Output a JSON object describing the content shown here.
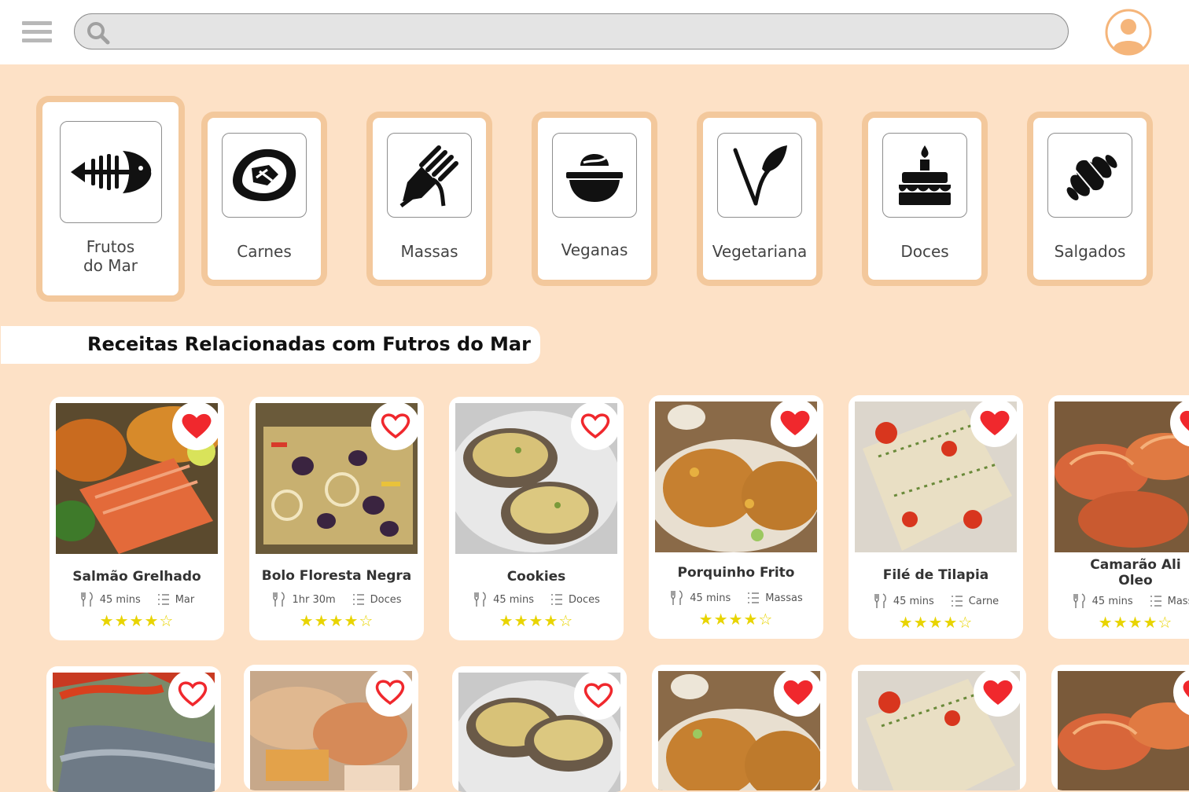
{
  "header": {
    "menu_icon": "hamburger-menu-icon",
    "search_icon": "search-icon",
    "search_value": "",
    "search_placeholder": "",
    "avatar_icon": "user-avatar-icon",
    "accent_color": "#F5B57A"
  },
  "categories": [
    {
      "label_line1": "Frutos",
      "label_line2": "do Mar",
      "icon": "fish-bone-icon",
      "selected": true
    },
    {
      "label_line1": "Carnes",
      "label_line2": "",
      "icon": "steak-icon",
      "selected": false
    },
    {
      "label_line1": "Massas",
      "label_line2": "",
      "icon": "pasta-fork-icon",
      "selected": false
    },
    {
      "label_line1": "Veganas",
      "label_line2": "",
      "icon": "bowl-icon",
      "selected": false
    },
    {
      "label_line1": "Vegetariana",
      "label_line2": "",
      "icon": "leaf-sprout-icon",
      "selected": false
    },
    {
      "label_line1": "Doces",
      "label_line2": "",
      "icon": "cake-icon",
      "selected": false
    },
    {
      "label_line1": "Salgados",
      "label_line2": "",
      "icon": "croissant-icon",
      "selected": false
    }
  ],
  "section_title": "Receitas Relacionadas com Futros do Mar",
  "recipes_row1": [
    {
      "title": "Salmão Grelhado",
      "time": "45 mins",
      "category": "Mar",
      "rating": 4,
      "max_rating": 5,
      "favorite": true
    },
    {
      "title": "Bolo Floresta Negra",
      "time": "1hr 30m",
      "category": "Doces",
      "rating": 4,
      "max_rating": 5,
      "favorite": false
    },
    {
      "title": "Cookies",
      "time": "45 mins",
      "category": "Doces",
      "rating": 4,
      "max_rating": 5,
      "favorite": false
    },
    {
      "title": "Porquinho Frito",
      "time": "45 mins",
      "category": "Massas",
      "rating": 4,
      "max_rating": 5,
      "favorite": true
    },
    {
      "title": "Filé de Tilapia",
      "time": "45 mins",
      "category": "Carne",
      "rating": 4,
      "max_rating": 5,
      "favorite": true
    },
    {
      "title": "Camarão Ali Oleo",
      "title_line1": "Camarão Ali",
      "title_line2": "Oleo",
      "time": "45 mins",
      "category": "Massa",
      "rating": 4,
      "max_rating": 5,
      "favorite": true
    }
  ],
  "recipes_row2": [
    {
      "favorite": false
    },
    {
      "favorite": false
    },
    {
      "favorite": false
    },
    {
      "favorite": true
    },
    {
      "favorite": true
    },
    {
      "favorite": true
    }
  ],
  "icons": {
    "utensils": "fork-knife-icon",
    "list": "list-icon",
    "star": "star-icon",
    "heart": "heart-icon"
  },
  "colors": {
    "background": "#FDE1C6",
    "category_border": "#F3C89C",
    "heart_red": "#F0282D",
    "star_yellow": "#E8D400"
  }
}
